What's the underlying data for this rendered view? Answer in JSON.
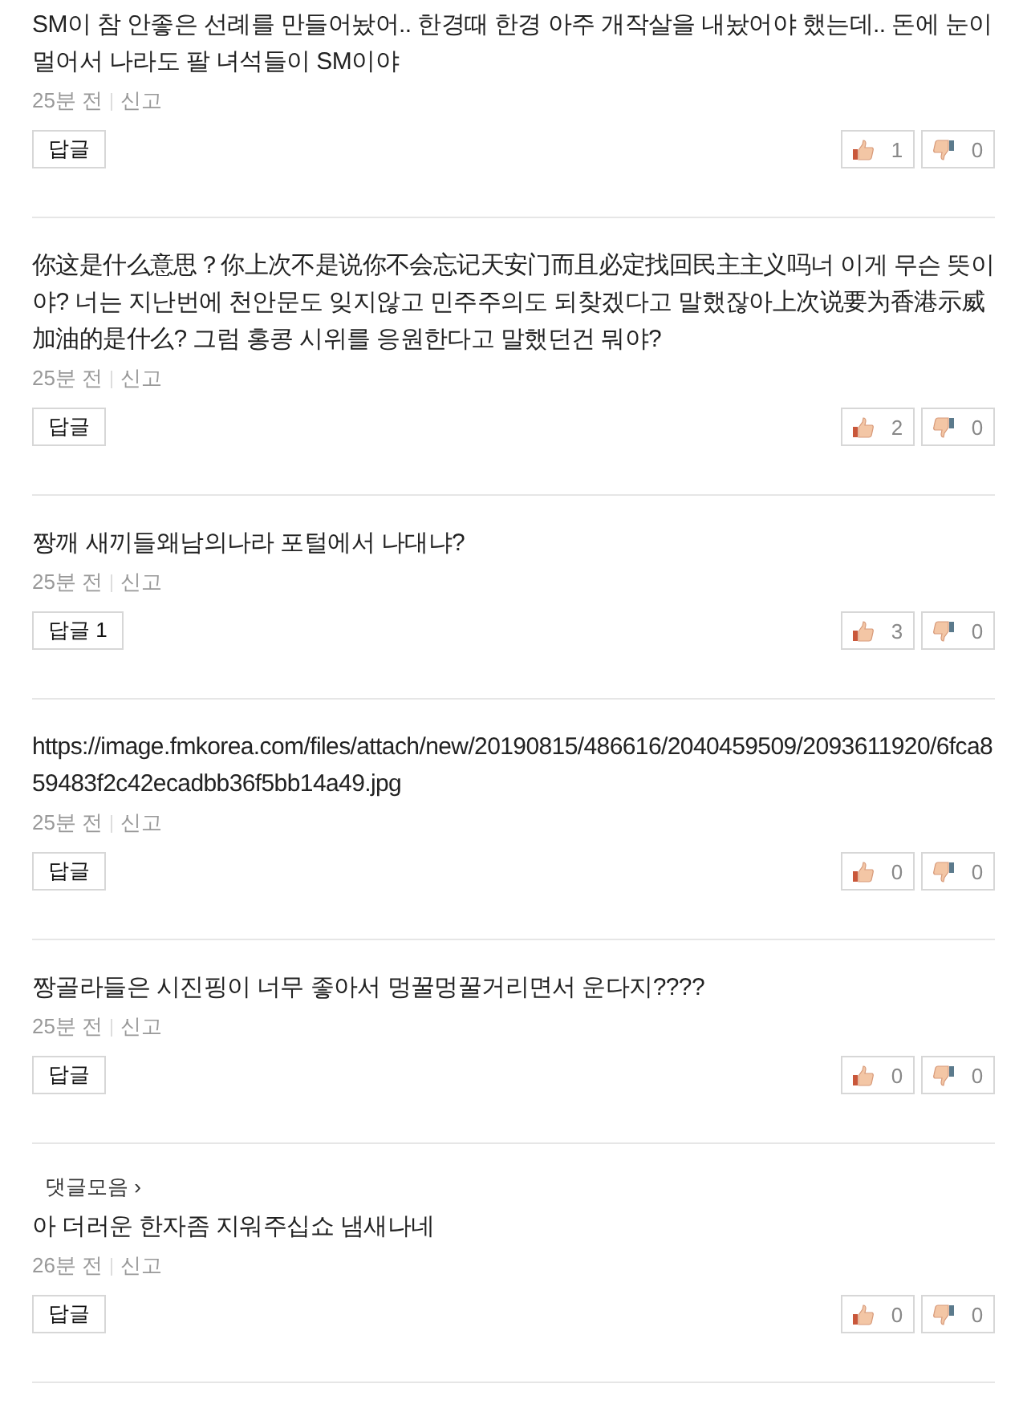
{
  "comments": [
    {
      "text": "SM이 참 안좋은 선례를 만들어놨어.. 한경때 한경 아주 개작살을 내놨어야 했는데.. 돈에 눈이 멀어서 나라도 팔 녀석들이 SM이야",
      "time": "25분 전",
      "report": "신고",
      "reply": "답글",
      "likes": "1",
      "dislikes": "0"
    },
    {
      "text": "你这是什么意思？你上次不是说你不会忘记天安门而且必定找回民主主义吗너 이게 무슨 뜻이야? 너는 지난번에 천안문도 잊지않고 민주주의도 되찾겠다고 말했잖아上次说要为香港示威加油的是什么? 그럼 홍콩 시위를 응원한다고 말했던건 뭐야?",
      "time": "25분 전",
      "report": "신고",
      "reply": "답글",
      "likes": "2",
      "dislikes": "0"
    },
    {
      "text": "짱깨 새끼들왜남의나라 포털에서 나대냐?",
      "time": "25분 전",
      "report": "신고",
      "reply": "답글 1",
      "likes": "3",
      "dislikes": "0"
    },
    {
      "text": "https://image.fmkorea.com/files/attach/new/20190815/486616/2040459509/2093611920/6fca859483f2c42ecadbb36f5bb14a49.jpg",
      "time": "25분 전",
      "report": "신고",
      "reply": "답글",
      "likes": "0",
      "dislikes": "0"
    },
    {
      "text": "짱골라들은 시진핑이 너무 좋아서 멍꿀멍꿀거리면서 운다지????",
      "time": "25분 전",
      "report": "신고",
      "reply": "답글",
      "likes": "0",
      "dislikes": "0"
    },
    {
      "collection_link": "댓글모음",
      "collection_arrow": "›",
      "text": "아 더러운 한자좀 지워주십쇼 냄새나네",
      "time": "26분 전",
      "report": "신고",
      "reply": "답글",
      "likes": "0",
      "dislikes": "0"
    }
  ]
}
